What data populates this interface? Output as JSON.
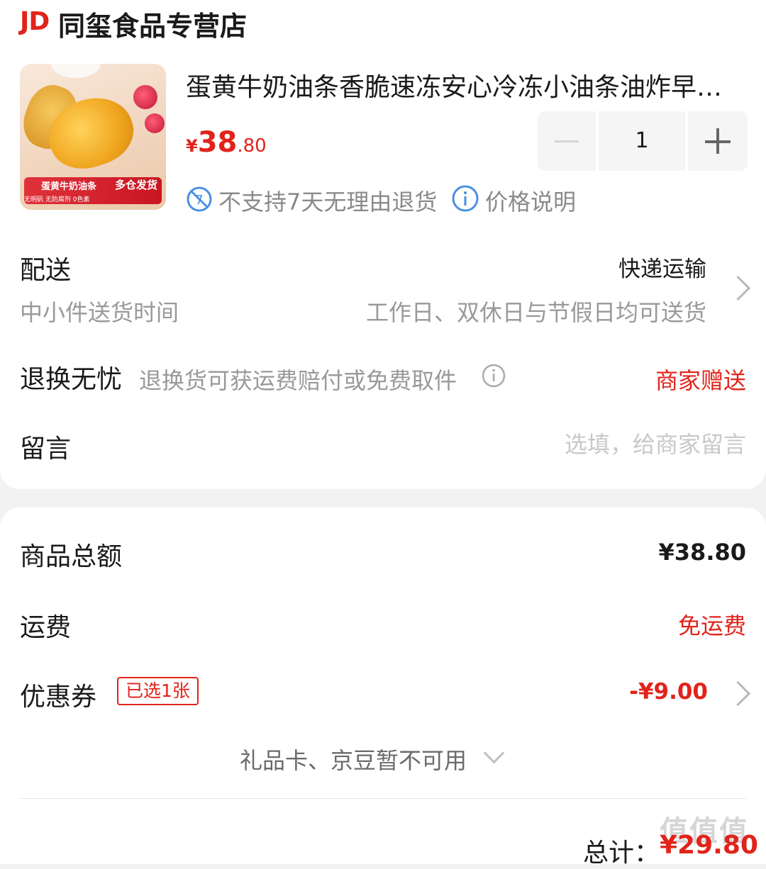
{
  "shop": {
    "badge": "JD",
    "name": "同玺食品专营店"
  },
  "product": {
    "title": "蛋黄牛奶油条香脆速冻安心冷冻小油条油炸早餐半成品",
    "price_symbol": "¥",
    "price_int": "38",
    "price_dec": ".80",
    "quantity": "1",
    "image_banner_main": "蛋黄牛奶油条",
    "image_banner_badge": "多仓发货",
    "image_banner_sub": "无明矾 无防腐剂 0色素",
    "no_return_text": "不支持7天无理由退货",
    "price_note": "价格说明"
  },
  "delivery": {
    "label": "配送",
    "method": "快递运输",
    "time_label": "中小件送货时间",
    "time_value": "工作日、双休日与节假日均可送货"
  },
  "returns": {
    "label": "退换无忧",
    "desc": "退换货可获运费赔付或免费取件",
    "value": "商家赠送"
  },
  "message": {
    "label": "留言",
    "placeholder": "选填，给商家留言"
  },
  "summary": {
    "goods_total_label": "商品总额",
    "goods_total_value": "¥38.80",
    "shipping_label": "运费",
    "shipping_value": "免运费",
    "coupon_label": "优惠券",
    "coupon_badge": "已选1张",
    "coupon_value": "-¥9.00",
    "gift_text": "礼品卡、京豆暂不可用"
  },
  "footer": {
    "total_label": "总计：",
    "total_value": "¥29.80",
    "watermark": "值值值"
  },
  "colors": {
    "accent": "#e2231a",
    "muted": "#999999"
  },
  "icons": [
    "no-return-icon",
    "info-icon",
    "minus-icon",
    "plus-icon",
    "chevron-right-icon",
    "chevron-down-icon"
  ]
}
